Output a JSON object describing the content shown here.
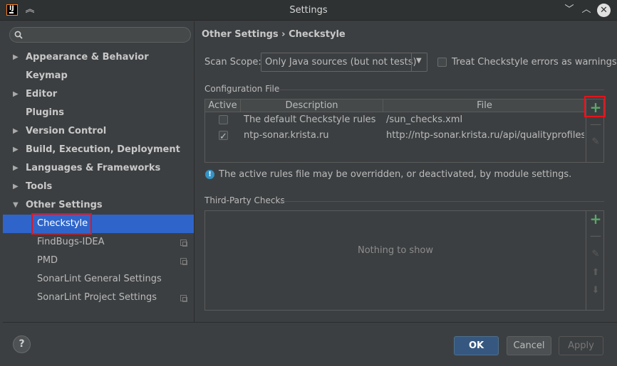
{
  "window": {
    "title": "Settings",
    "app_icon_text": "IJ"
  },
  "sidebar": {
    "search": {
      "placeholder": "",
      "value": ""
    },
    "items": [
      {
        "label": "Appearance & Behavior",
        "expandable": true
      },
      {
        "label": "Keymap",
        "expandable": false
      },
      {
        "label": "Editor",
        "expandable": true
      },
      {
        "label": "Plugins",
        "expandable": false
      },
      {
        "label": "Version Control",
        "expandable": true
      },
      {
        "label": "Build, Execution, Deployment",
        "expandable": true
      },
      {
        "label": "Languages & Frameworks",
        "expandable": true
      },
      {
        "label": "Tools",
        "expandable": true
      },
      {
        "label": "Other Settings",
        "expandable": true,
        "expanded": true
      }
    ],
    "children": [
      {
        "label": "Checkstyle",
        "selected": true
      },
      {
        "label": "FindBugs-IDEA",
        "project_icon": true
      },
      {
        "label": "PMD",
        "project_icon": true
      },
      {
        "label": "SonarLint General Settings"
      },
      {
        "label": "SonarLint Project Settings",
        "project_icon": true
      }
    ]
  },
  "breadcrumb": {
    "parent": "Other Settings",
    "separator": "›",
    "current": "Checkstyle"
  },
  "scan": {
    "label": "Scan Scope:",
    "value": "Only Java sources (but not tests)",
    "treat_label": "Treat Checkstyle errors as warnings",
    "treat_checked": false
  },
  "config": {
    "title": "Configuration File",
    "columns": [
      "Active",
      "Description",
      "File"
    ],
    "rows": [
      {
        "active": false,
        "description": "The default Checkstyle rules",
        "file": "/sun_checks.xml"
      },
      {
        "active": true,
        "description": "ntp-sonar.krista.ru",
        "file": "http://ntp-sonar.krista.ru/api/qualityprofiles..."
      }
    ]
  },
  "info": {
    "text": "The active rules file may be overridden, or deactivated, by module settings."
  },
  "third_party": {
    "title": "Third-Party Checks",
    "empty_text": "Nothing to show"
  },
  "footer": {
    "help": "?",
    "ok": "OK",
    "cancel": "Cancel",
    "apply": "Apply"
  },
  "colors": {
    "selection": "#2f65ca",
    "highlight_box": "#e8131a",
    "add_green": "#59a869",
    "ok_blue": "#365880"
  }
}
